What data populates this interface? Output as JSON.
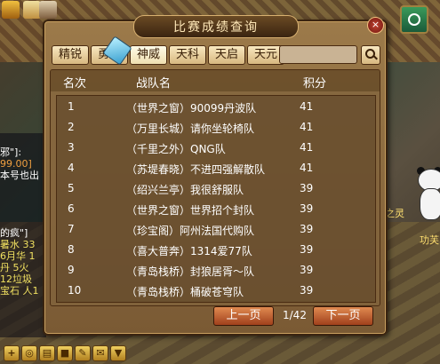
{
  "dialog": {
    "title": "比赛成绩查询",
    "close_label": "×",
    "tabs": [
      {
        "label": "精锐",
        "active": false
      },
      {
        "label": "勇武",
        "active": false
      },
      {
        "label": "神威",
        "active": true
      },
      {
        "label": "天科",
        "active": false
      },
      {
        "label": "天启",
        "active": false
      },
      {
        "label": "天元",
        "active": false
      }
    ],
    "search": {
      "value": "",
      "placeholder": ""
    },
    "columns": {
      "rank": "名次",
      "team": "战队名",
      "score": "积分"
    },
    "rows": [
      {
        "rank": "1",
        "team": "（世界之窗）90099丹波队",
        "score": "41"
      },
      {
        "rank": "2",
        "team": "（万里长城）请你坐轮椅队",
        "score": "41"
      },
      {
        "rank": "3",
        "team": "（千里之外）QNG队",
        "score": "41"
      },
      {
        "rank": "4",
        "team": "（苏堤春晓）不进四强解散队",
        "score": "41"
      },
      {
        "rank": "5",
        "team": "（绍兴兰亭）我很舒服队",
        "score": "39"
      },
      {
        "rank": "6",
        "team": "（世界之窗）世界招个封队",
        "score": "39"
      },
      {
        "rank": "7",
        "team": "（珍宝阁）阿州法国代购队",
        "score": "39"
      },
      {
        "rank": "8",
        "team": "（喜大普奔）1314爱77队",
        "score": "39"
      },
      {
        "rank": "9",
        "team": "（青岛栈桥）封狼居胥～队",
        "score": "39"
      },
      {
        "rank": "10",
        "team": "（青岛栈桥）桶破苍穹队",
        "score": "39"
      }
    ],
    "prev_label": "上一页",
    "next_label": "下一页",
    "page_indicator": "1/42"
  },
  "chat": {
    "lines": [
      {
        "text": "邪\"]:",
        "color": "white"
      },
      {
        "text": "99.00]",
        "color": "orange"
      },
      {
        "text": "本号也出",
        "color": "white"
      },
      {
        "text": "",
        "color": "white"
      },
      {
        "text": "",
        "color": "white"
      },
      {
        "text": "",
        "color": "white"
      },
      {
        "text": "",
        "color": "white"
      },
      {
        "text": "的疯\"]",
        "color": "white"
      },
      {
        "text": "暑水 33",
        "color": "yellow"
      },
      {
        "text": "6月华 1",
        "color": "yellow"
      },
      {
        "text": "丹 5火",
        "color": "yellow"
      },
      {
        "text": "12垃圾",
        "color": "yellow"
      },
      {
        "text": "宝石 人1",
        "color": "yellow"
      }
    ]
  },
  "scene": {
    "right_text_1": "之灵",
    "right_text_2": "功芙"
  },
  "toolbar": {
    "icons": [
      "+",
      "🔍",
      "▤",
      "🔒",
      "✎",
      "✉",
      "▼"
    ]
  },
  "colors": {
    "dialog_bg": "#8a6a3e",
    "tab_bg": "#f0dcaa",
    "pager_btn": "#c8602c",
    "text": "#ffffff"
  }
}
